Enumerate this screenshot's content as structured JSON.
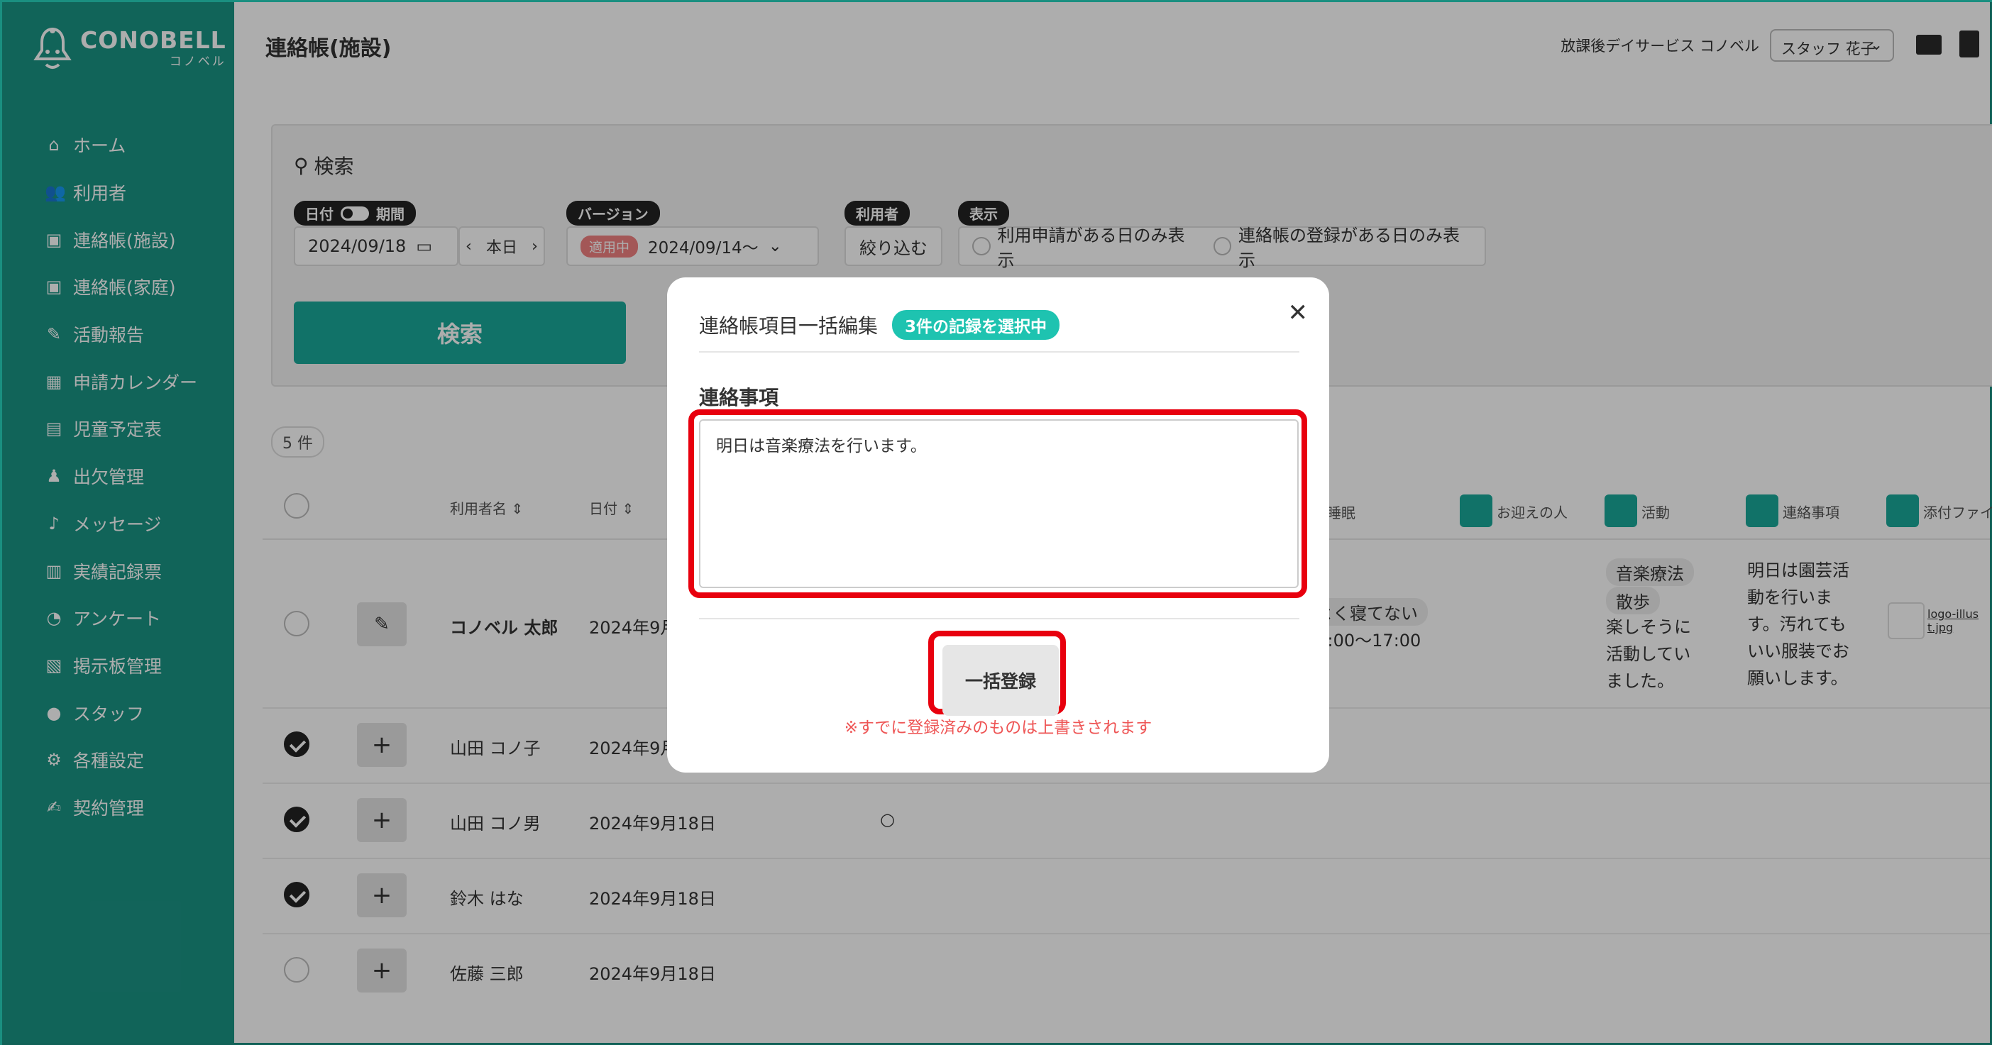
{
  "brand": {
    "name": "CONOBELL",
    "sub": "コノベル"
  },
  "sidebar": {
    "items": [
      {
        "label": "ホーム",
        "icon": "home-icon",
        "glyph": "⌂"
      },
      {
        "label": "利用者",
        "icon": "users-icon",
        "glyph": "👥"
      },
      {
        "label": "連絡帳(施設)",
        "icon": "notebook-icon",
        "glyph": "▣"
      },
      {
        "label": "連絡帳(家庭)",
        "icon": "notebook-icon",
        "glyph": "▣"
      },
      {
        "label": "活動報告",
        "icon": "report-icon",
        "glyph": "✎"
      },
      {
        "label": "申請カレンダー",
        "icon": "calendar-icon",
        "glyph": "▦"
      },
      {
        "label": "児童予定表",
        "icon": "schedule-icon",
        "glyph": "▤"
      },
      {
        "label": "出欠管理",
        "icon": "attendance-icon",
        "glyph": "♟"
      },
      {
        "label": "メッセージ",
        "icon": "bell-icon",
        "glyph": "♪"
      },
      {
        "label": "実績記録票",
        "icon": "table-icon",
        "glyph": "▥"
      },
      {
        "label": "アンケート",
        "icon": "pie-chart-icon",
        "glyph": "◔"
      },
      {
        "label": "掲示板管理",
        "icon": "board-icon",
        "glyph": "▧"
      },
      {
        "label": "スタッフ",
        "icon": "staff-icon",
        "glyph": "●"
      },
      {
        "label": "各種設定",
        "icon": "gear-icon",
        "glyph": "⚙"
      },
      {
        "label": "契約管理",
        "icon": "contract-icon",
        "glyph": "✍"
      }
    ]
  },
  "header": {
    "title": "連絡帳(施設)",
    "facility": "放課後デイサービス コノベル",
    "staff": "スタッフ 花子"
  },
  "search": {
    "title": "検索",
    "date_tag_left": "日付",
    "date_tag_right": "期間",
    "date_value": "2024/09/18",
    "today_label": "本日",
    "version_tag": "バージョン",
    "version_badge": "適用中",
    "version_value": "2024/09/14〜",
    "user_tag": "利用者",
    "user_filter": "絞り込む",
    "display_tag": "表示",
    "opt1": "利用申請がある日のみ表示",
    "opt2": "連絡帳の登録がある日のみ表示",
    "button": "検索"
  },
  "count": "5 件",
  "columns": {
    "name": "利用者名",
    "date": "日付",
    "sleep": "睡眠",
    "pickup": "お迎えの人",
    "activity": "活動",
    "notes": "連絡事項",
    "attach": "添付ファイ"
  },
  "rows": [
    {
      "name": "コノベル 太郎",
      "date": "2024年9月18日",
      "checked": false,
      "mark": "",
      "sleep": "よく寝てない",
      "sleep_time": "16:00〜17:00",
      "activities": [
        "音楽療法",
        "散歩"
      ],
      "activity_note": "楽しそうに活動していました。",
      "note": "明日は園芸活動を行います。汚れてもいい服装でお願いします。",
      "attachment": "logo-illust.jpg"
    },
    {
      "name": "山田 コノ子",
      "date": "2024年9月18日",
      "checked": true,
      "mark": ""
    },
    {
      "name": "山田 コノ男",
      "date": "2024年9月18日",
      "checked": true,
      "mark": "○"
    },
    {
      "name": "鈴木 はな",
      "date": "2024年9月18日",
      "checked": true,
      "mark": ""
    },
    {
      "name": "佐藤 三郎",
      "date": "2024年9月18日",
      "checked": false,
      "mark": ""
    }
  ],
  "modal": {
    "title": "連絡帳項目一括編集",
    "selected_badge": "3件の記録を選択中",
    "field_label": "連絡事項",
    "text_value": "明日は音楽療法を行います。",
    "submit": "一括登録",
    "warning": "※すでに登録済みのものは上書きされます"
  },
  "colors": {
    "brand": "#1a9484",
    "accent": "#1aa99a",
    "badge": "#1ec3b0",
    "highlight": "#e8000e",
    "warning": "#ee5555"
  }
}
